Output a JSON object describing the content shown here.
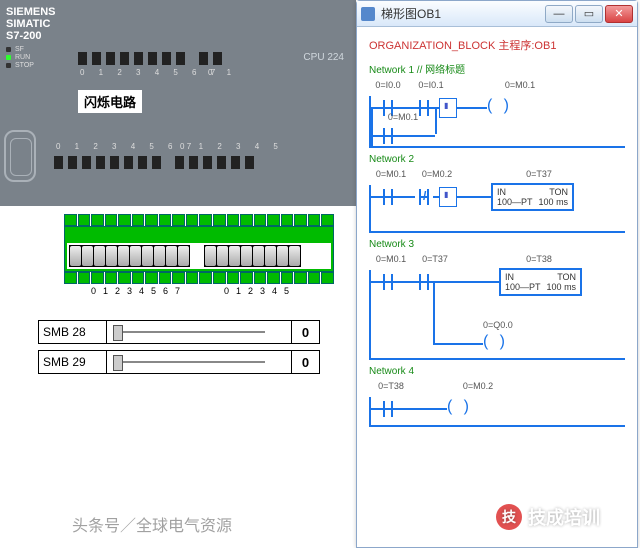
{
  "plc": {
    "brand_line1": "SIEMENS",
    "brand_line2": "SIMATIC",
    "brand_line3": "S7-200",
    "leds": {
      "sf": "SF",
      "run": "RUN",
      "stop": "STOP"
    },
    "cpu_label": "CPU 224",
    "flash_text": "闪烁电路",
    "input_nums_a": "0 1 2 3 4 5 6 7",
    "input_nums_b": "0 1",
    "output_nums_a": "0 1 2 3 4 5 6 7",
    "output_nums_b": "0 1 2 3 4 5"
  },
  "terminals": {
    "nums_a": [
      "0",
      "1",
      "2",
      "3",
      "4",
      "5",
      "6",
      "7"
    ],
    "nums_b": [
      "0",
      "1",
      "2",
      "3",
      "4",
      "5"
    ]
  },
  "smb": [
    {
      "label": "SMB 28",
      "value": "0"
    },
    {
      "label": "SMB 29",
      "value": "0"
    }
  ],
  "window": {
    "title": "梯形图OB1",
    "min": "—",
    "max": "▭",
    "close": "✕",
    "ob_title": "ORGANIZATION_BLOCK 主程序:OB1",
    "networks": [
      {
        "title": "Network 1 // 网络标题",
        "labels": [
          "0=I0.0",
          "0=I0.1",
          "",
          "0=M0.1"
        ],
        "branch_label": "0=M0.1"
      },
      {
        "title": "Network 2",
        "labels": [
          "0=M0.1",
          "0=M0.2",
          "",
          "0=T37"
        ],
        "timer": {
          "name": "TON",
          "in": "IN",
          "pt_val": "100",
          "pt": "PT",
          "base": "100 ms"
        }
      },
      {
        "title": "Network 3",
        "labels": [
          "0=M0.1",
          "0=T37",
          "",
          "0=T38"
        ],
        "timer": {
          "name": "TON",
          "in": "IN",
          "pt_val": "100",
          "pt": "PT",
          "base": "100 ms"
        },
        "out_label": "0=Q0.0"
      },
      {
        "title": "Network 4",
        "labels": [
          "0=T38",
          "",
          "0=M0.2"
        ]
      }
    ]
  },
  "watermarks": {
    "wm1": "技成培训",
    "wm2": "头条号／全球电气资源"
  }
}
